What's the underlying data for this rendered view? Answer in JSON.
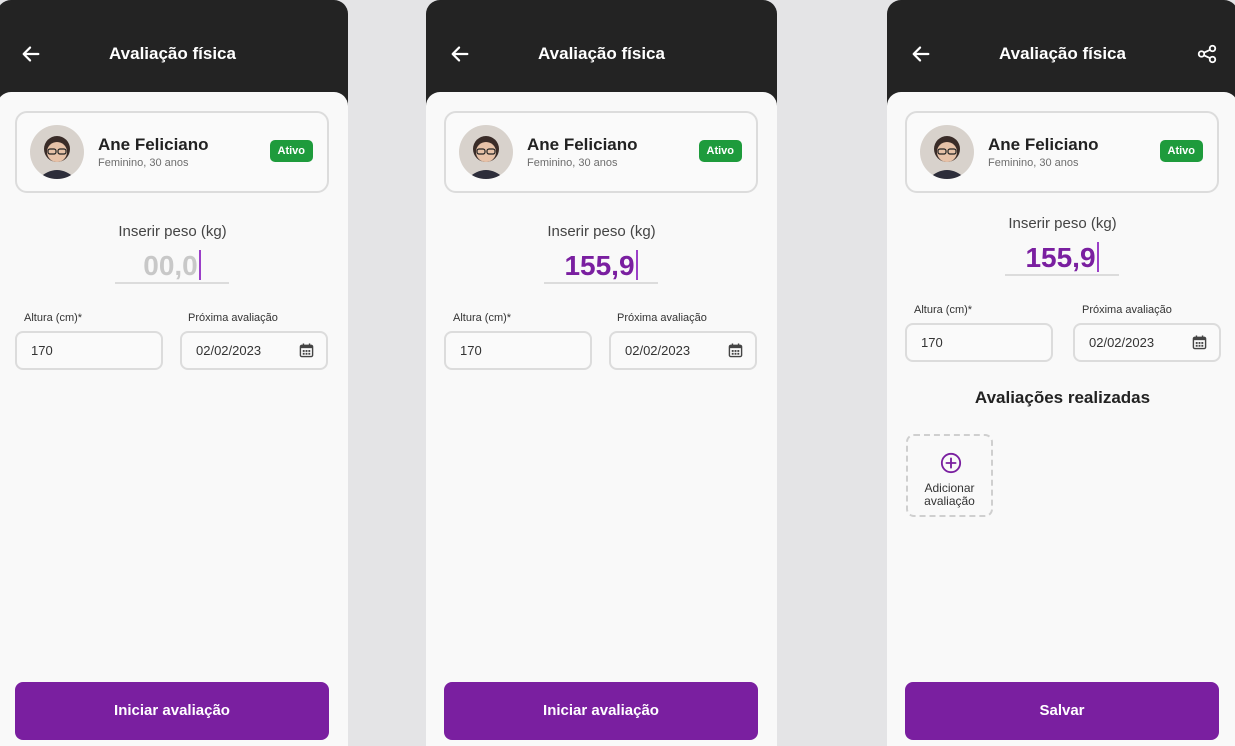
{
  "header": {
    "title": "Avaliação física"
  },
  "profile": {
    "name": "Ane Feliciano",
    "info": "Feminino, 30 anos",
    "status": "Ativo"
  },
  "weight": {
    "label": "Inserir peso (kg)",
    "placeholder": "00,0",
    "value": "155,9"
  },
  "height_field": {
    "label": "Altura (cm)*",
    "value": "170"
  },
  "next_eval_field": {
    "label": "Próxima avaliação",
    "value": "02/02/2023"
  },
  "evaluations": {
    "title": "Avaliações realizadas",
    "add_line1": "Adicionar",
    "add_line2": "avaliação"
  },
  "buttons": {
    "start": "Iniciar avaliação",
    "save": "Salvar"
  },
  "colors": {
    "accent": "#7a1fa0",
    "appbar": "#232323",
    "badge": "#1e9b3c",
    "background": "#e4e4e6"
  },
  "icons": {
    "back": "arrow-left-icon",
    "share": "share-icon",
    "calendar": "calendar-icon",
    "add": "plus-circle-icon"
  }
}
